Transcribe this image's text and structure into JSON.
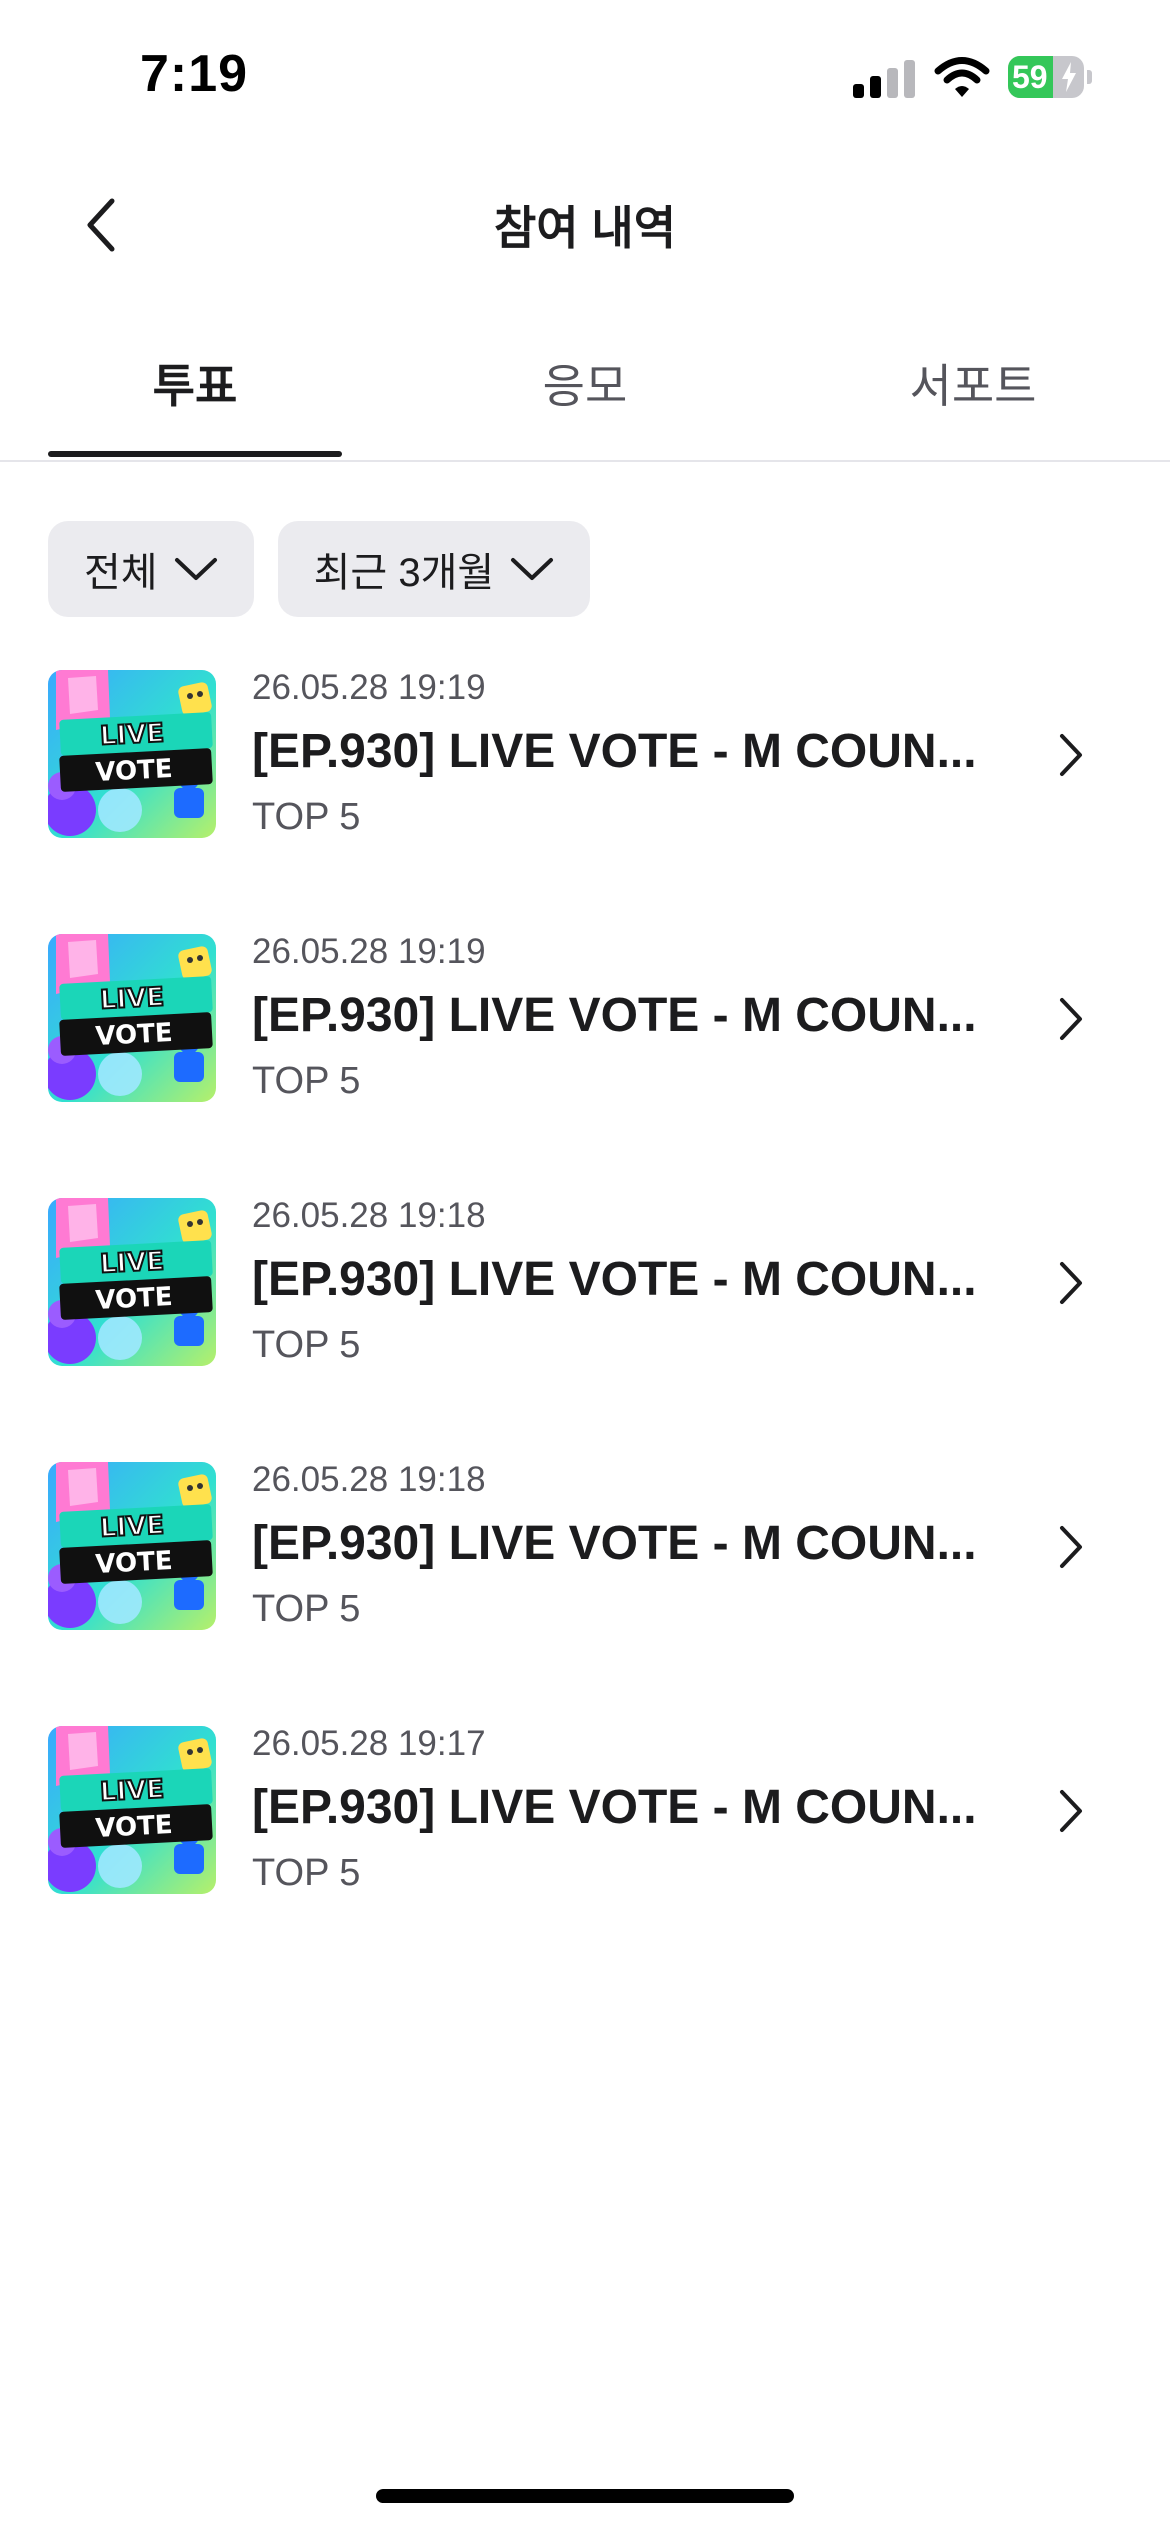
{
  "status_bar": {
    "time": "7:19",
    "battery": "59"
  },
  "header": {
    "title": "참여 내역"
  },
  "tabs": [
    {
      "label": "투표",
      "active": true
    },
    {
      "label": "응모",
      "active": false
    },
    {
      "label": "서포트",
      "active": false
    }
  ],
  "filters": {
    "category": "전체",
    "period": "최근 3개월"
  },
  "thumbnail": {
    "line1": "LIVE",
    "line2": "VOTE"
  },
  "items": [
    {
      "date": "26.05.28 19:19",
      "title": "[EP.930] LIVE VOTE - M COUN...",
      "subtitle": "TOP 5"
    },
    {
      "date": "26.05.28 19:19",
      "title": "[EP.930] LIVE VOTE - M COUN...",
      "subtitle": "TOP 5"
    },
    {
      "date": "26.05.28 19:18",
      "title": "[EP.930] LIVE VOTE - M COUN...",
      "subtitle": "TOP 5"
    },
    {
      "date": "26.05.28 19:18",
      "title": "[EP.930] LIVE VOTE - M COUN...",
      "subtitle": "TOP 5"
    },
    {
      "date": "26.05.28 19:17",
      "title": "[EP.930] LIVE VOTE - M COUN...",
      "subtitle": "TOP 5"
    }
  ],
  "colors": {
    "battery_green": "#34c759",
    "text_primary": "#1c1c1e",
    "text_secondary": "#55555c",
    "chip_background": "#ebebef"
  }
}
